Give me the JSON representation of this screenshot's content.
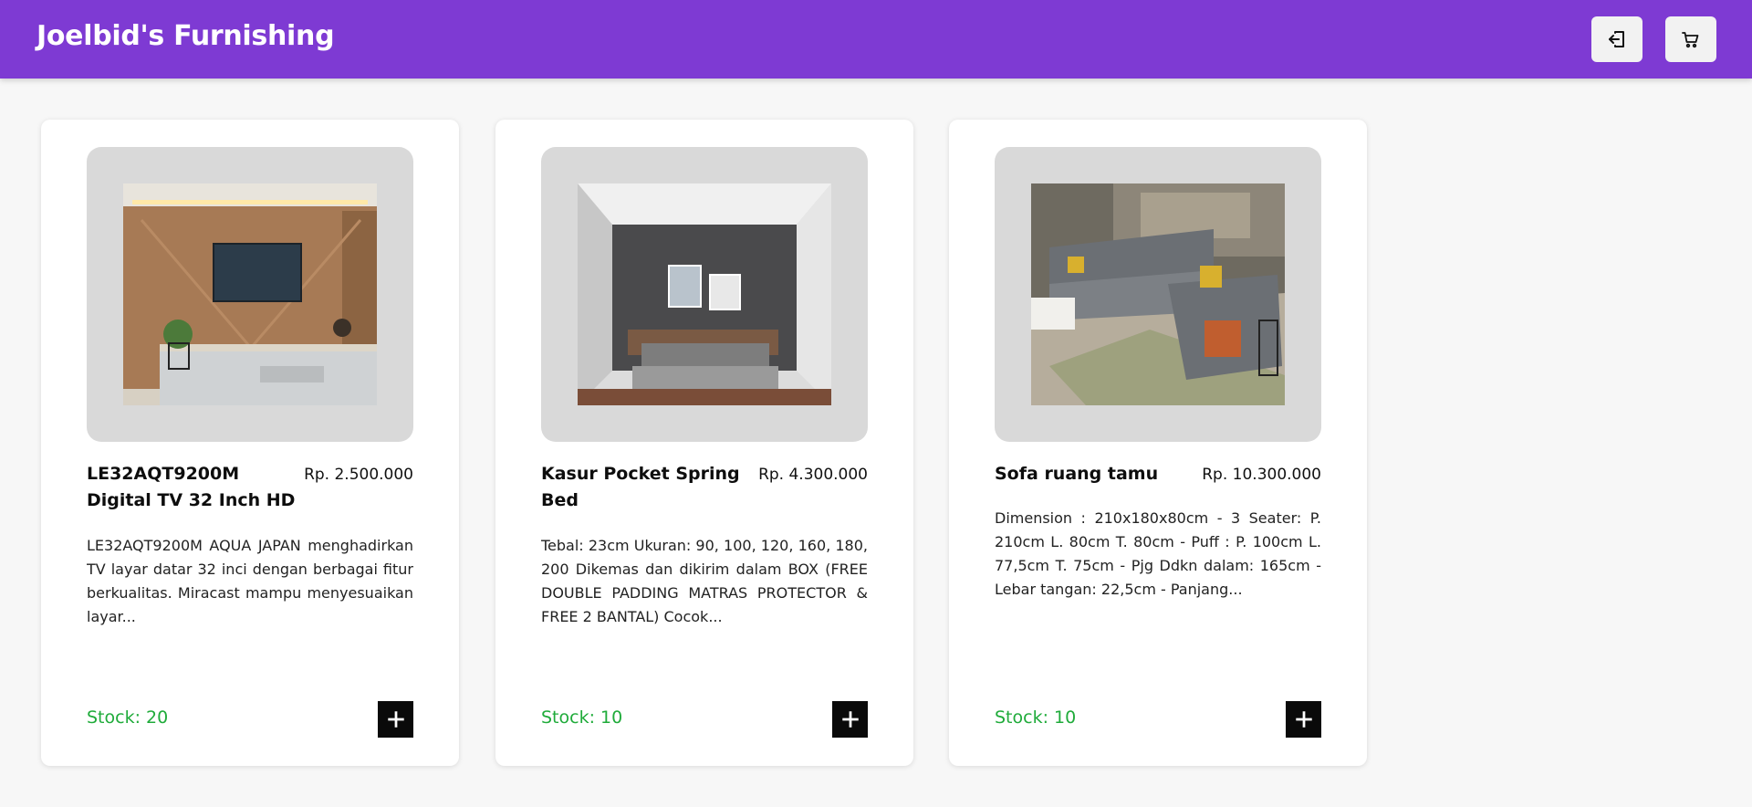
{
  "header": {
    "brand": "Joelbid's Furnishing",
    "login_icon": "login-icon",
    "cart_icon": "cart-icon",
    "accent_color": "#7e3ad3"
  },
  "products": [
    {
      "name": "LE32AQT9200M Digital TV 32 Inch HD",
      "price": "Rp. 2.500.000",
      "description": "LE32AQT9200M AQUA JAPAN menghadirkan TV layar datar 32 inci dengan berbagai fitur berkualitas. Miracast mampu menyesuaikan layar...",
      "stock": "Stock: 20",
      "image_icon": "tv-room-photo"
    },
    {
      "name": "Kasur Pocket Spring Bed",
      "price": "Rp. 4.300.000",
      "description": "Tebal: 23cm Ukuran: 90, 100, 120, 160, 180, 200 Dikemas dan dikirim dalam BOX (FREE DOUBLE PADDING MATRAS PROTECTOR & FREE 2 BANTAL) Cocok...",
      "stock": "Stock: 10",
      "image_icon": "bedroom-photo"
    },
    {
      "name": "Sofa ruang tamu",
      "price": "Rp. 10.300.000",
      "description": "Dimension : 210x180x80cm - 3 Seater: P. 210cm L. 80cm T. 80cm - Puff : P. 100cm L. 77,5cm T. 75cm - Pjg Ddkn dalam: 165cm - Lebar tangan: 22,5cm - Panjang...",
      "stock": "Stock: 10",
      "image_icon": "sofa-photo"
    }
  ],
  "stock_color": "#1fab3a"
}
